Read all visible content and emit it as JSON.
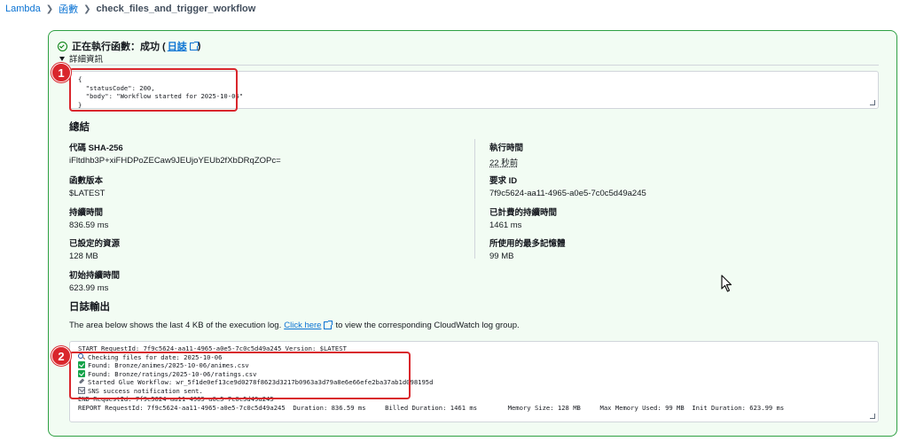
{
  "breadcrumb": {
    "root": "Lambda",
    "section": "函數",
    "current": "check_files_and_trigger_workflow"
  },
  "result": {
    "status_text": "正在執行函數：成功 (",
    "log_link": "日誌",
    "status_close": ")",
    "details_toggle": "詳細資訊",
    "response_lines": [
      "{",
      "  \"statusCode\": 200,",
      "  \"body\": \"Workflow started for 2025-10-06\"",
      "}"
    ]
  },
  "summary": {
    "title": "總結",
    "fields": [
      {
        "label": "代碼 SHA-256",
        "value": "iFltdhb3P+xiFHDPoZECaw9JEUjoYEUb2fXbDRqZOPc="
      },
      {
        "label": "執行時間",
        "value": "22 秒前"
      },
      {
        "label": "函數版本",
        "value": "$LATEST"
      },
      {
        "label": "要求 ID",
        "value": "7f9c5624-aa11-4965-a0e5-7c0c5d49a245"
      },
      {
        "label": "持續時間",
        "value": "836.59 ms"
      },
      {
        "label": "已計費的持續時間",
        "value": "1461 ms"
      },
      {
        "label": "已設定的資源",
        "value": "128 MB"
      },
      {
        "label": "所使用的最多記憶體",
        "value": "99 MB"
      },
      {
        "label": "初始持續時間",
        "value": "623.99 ms"
      }
    ]
  },
  "log_output": {
    "title": "日誌輸出",
    "desc_before": "The area below shows the last 4 KB of the execution log.",
    "click_here": "Click here",
    "desc_after": "to view the corresponding CloudWatch log group.",
    "lines": [
      "START RequestId: 7f9c5624-aa11-4965-a0e5-7c0c5d49a245 Version: $LATEST",
      "Checking files for date: 2025-10-06",
      "Found: Bronze/animes/2025-10-06/animes.csv",
      "Found: Bronze/ratings/2025-10-06/ratings.csv",
      "Started Glue Workflow: wr_5f1de0ef13ce9d0278f8623d3217b0963a3d79a8e6e66efe2ba37ab1d098195d",
      "SNS success notification sent.",
      "END RequestId: 7f9c5624-aa11-4965-a0e5-7c0c5d49a245",
      "REPORT RequestId: 7f9c5624-aa11-4965-a0e5-7c0c5d49a245  Duration: 836.59 ms     Billed Duration: 1461 ms        Memory Size: 128 MB     Max Memory Used: 99 MB  Init Duration: 623.99 ms"
    ]
  },
  "annotations": {
    "badge1": "1",
    "badge2": "2"
  },
  "colors": {
    "success": "#037f0c",
    "panel_bg": "#f2fcf3",
    "link": "#0972d3",
    "highlight": "#d9262c"
  }
}
